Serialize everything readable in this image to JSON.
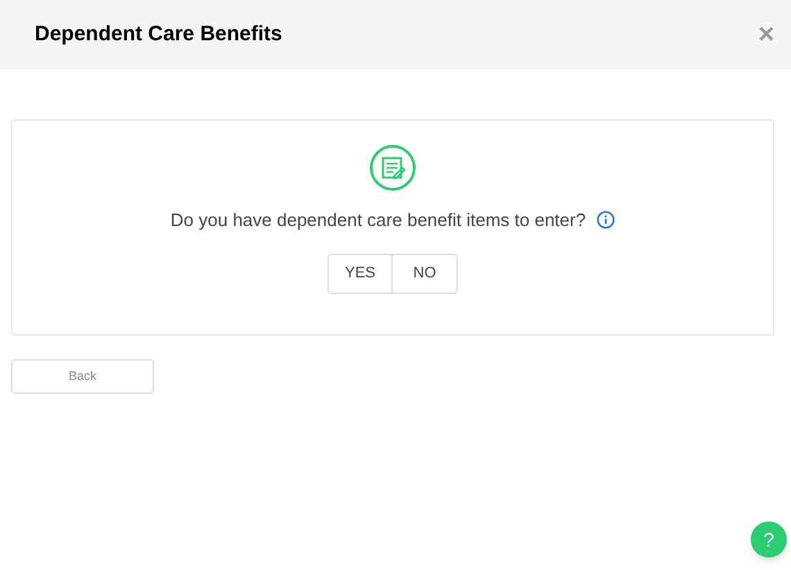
{
  "header": {
    "title": "Dependent Care Benefits",
    "close": "×"
  },
  "question": {
    "text": "Do you have dependent care benefit items to enter?"
  },
  "options": [
    "YES",
    "NO"
  ],
  "back": "Back",
  "help": "?"
}
